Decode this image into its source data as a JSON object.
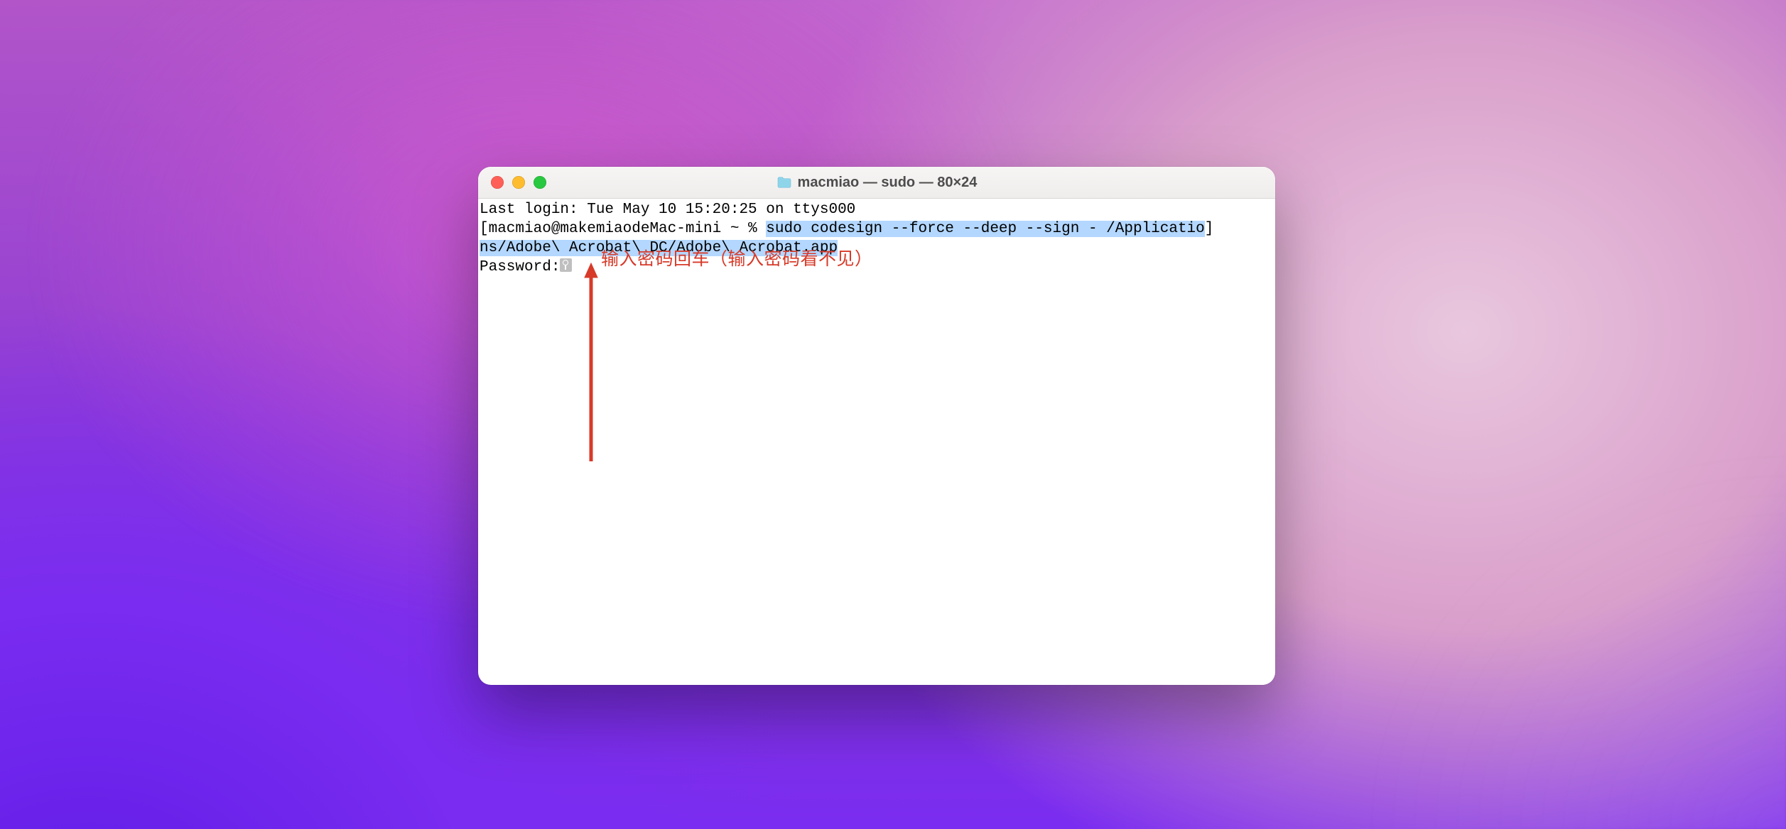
{
  "window": {
    "title": "macmiao — sudo — 80×24"
  },
  "terminal": {
    "last_login_line": "Last login: Tue May 10 15:20:25 on ttys000",
    "prompt_prefix": "[macmiao@makemiaodeMac-mini ~ % ",
    "cmd_part1": "sudo codesign --force --deep --sign - /Applicatio",
    "cmd_part2_wrap": "ns/Adobe\\ Acrobat\\ DC/Adobe\\ Acrobat.app",
    "wrap_suffix": "]",
    "password_label": "Password:"
  },
  "annotation": {
    "text": "输入密码回车（输入密码看不见）"
  }
}
